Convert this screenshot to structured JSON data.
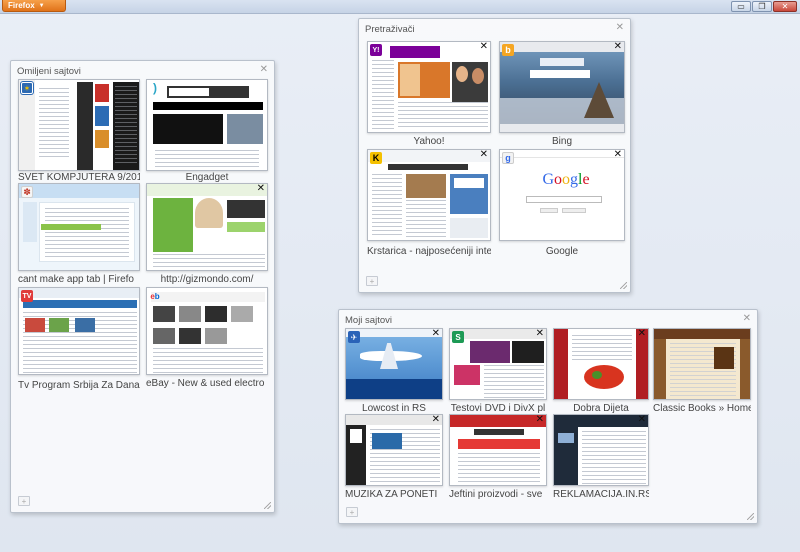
{
  "window": {
    "app_button": "Firefox",
    "controls": {
      "minimize": "▭",
      "restore": "❐",
      "close": "✕"
    }
  },
  "groups": {
    "favorites": {
      "title": "Omiljeni sajtovi",
      "tabs": [
        {
          "label": "SVET KOMPJUTERA 9/201",
          "favicon": "sk"
        },
        {
          "label": "Engadget",
          "favicon": "engadget"
        },
        {
          "label": "cant make app tab | Firefo",
          "favicon": "mozilla"
        },
        {
          "label": "http://gizmondo.com/",
          "favicon": "gizmondo"
        },
        {
          "label": "Tv Program Srbija Za Dana",
          "favicon": "tv"
        },
        {
          "label": "eBay - New & used electro",
          "favicon": "ebay"
        }
      ]
    },
    "search": {
      "title": "Pretraživači",
      "tabs": [
        {
          "label": "Yahoo!",
          "favicon": "Y!"
        },
        {
          "label": "Bing",
          "favicon": "b"
        },
        {
          "label": "Krstarica - najposećeniji inte",
          "favicon": "K"
        },
        {
          "label": "Google",
          "favicon": "g"
        }
      ]
    },
    "mysites": {
      "title": "Moji sajtovi",
      "tabs": [
        {
          "label": "Lowcost in RS",
          "favicon": "plane"
        },
        {
          "label": "Testovi DVD i DivX pl",
          "favicon": "S"
        },
        {
          "label": "Dobra Dijeta",
          "favicon": "diet"
        },
        {
          "label": "Classic Books » Home",
          "favicon": "book"
        },
        {
          "label": "MUZIKA ZA PONETI",
          "favicon": "music"
        },
        {
          "label": "Jeftini proizvodi - sve",
          "favicon": "cheap"
        },
        {
          "label": "REKLAMACIJA.IN.RS",
          "favicon": "rek"
        }
      ]
    }
  },
  "icons": {
    "close": "✕",
    "new_tab": "+"
  }
}
